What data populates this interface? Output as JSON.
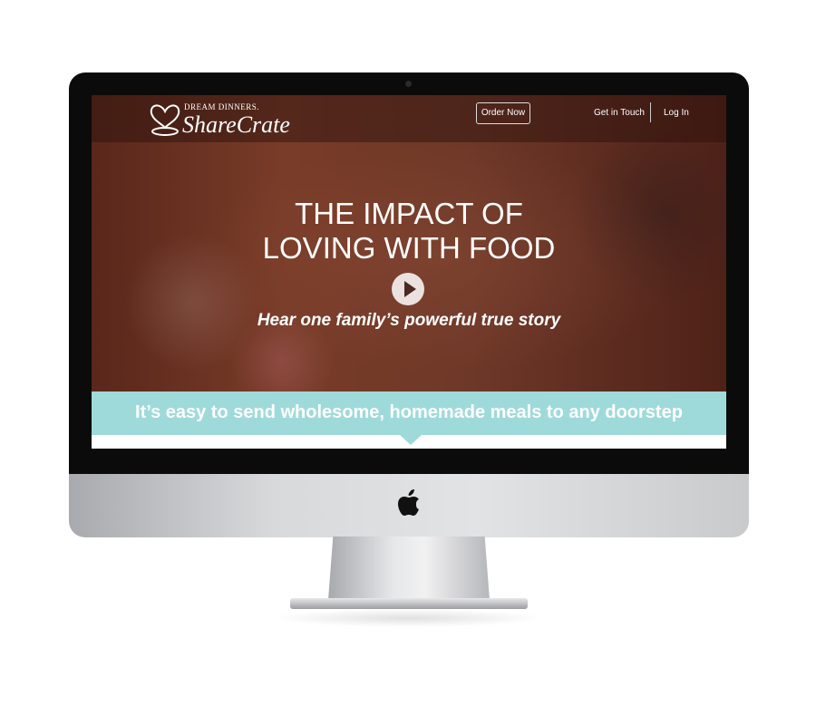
{
  "site": {
    "logo": {
      "top": "DREAM DINNERS.",
      "main": "ShareCrate"
    },
    "nav": {
      "order_now": "Order Now",
      "get_in_touch": "Get in Touch",
      "log_in": "Log In"
    },
    "hero": {
      "headline_line1": "THE IMPACT OF",
      "headline_line2": "LOVING WITH FOOD",
      "subtitle": "Hear one family’s powerful true story",
      "play_icon": "play-icon"
    },
    "band": {
      "text": "It’s easy to send wholesome, homemade meals to any doorstep"
    }
  },
  "colors": {
    "band": "#9fdadb",
    "bezel": "#0b0b0b"
  }
}
